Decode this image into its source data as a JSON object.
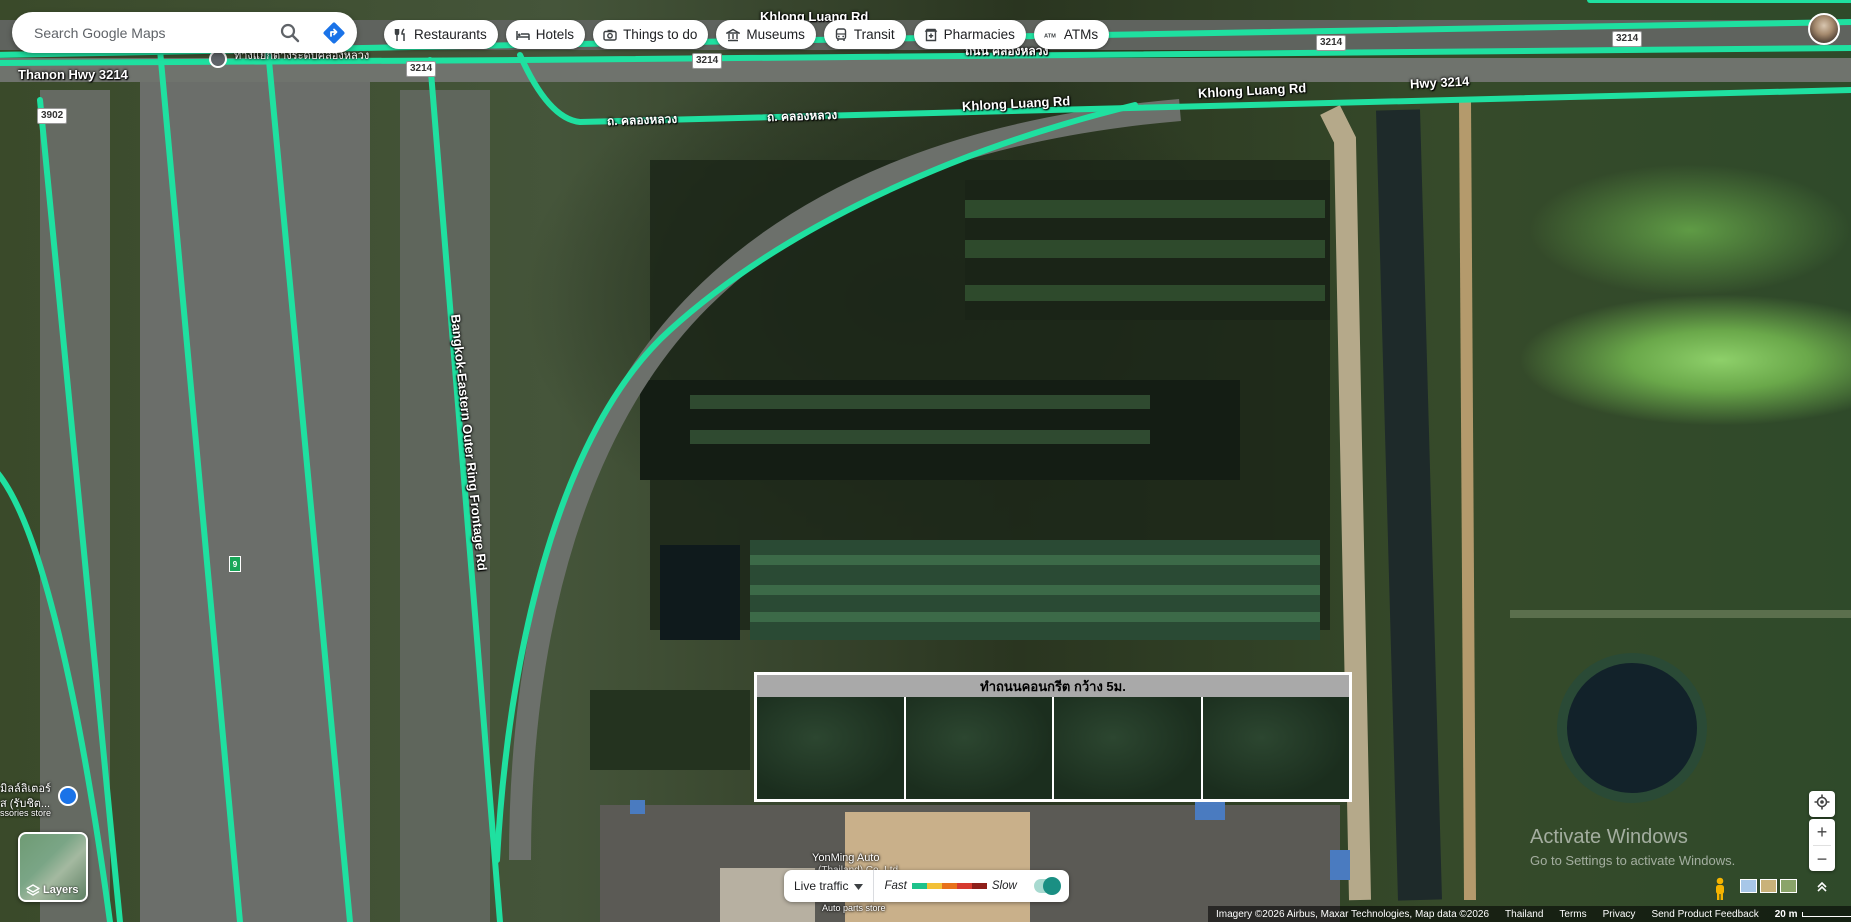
{
  "search": {
    "placeholder": "Search Google Maps"
  },
  "chips": [
    {
      "label": "Restaurants",
      "icon": "fork-knife-icon"
    },
    {
      "label": "Hotels",
      "icon": "bed-icon"
    },
    {
      "label": "Things to do",
      "icon": "camera-icon"
    },
    {
      "label": "Museums",
      "icon": "museum-icon"
    },
    {
      "label": "Transit",
      "icon": "bus-icon"
    },
    {
      "label": "Pharmacies",
      "icon": "pharmacy-icon"
    },
    {
      "label": "ATMs",
      "icon": "atm-icon"
    }
  ],
  "map_labels": {
    "road_top_thai_1": "Khlong Luang Rd",
    "road_top_thai_2": "ถนน คลองหลวง",
    "thanon_hwy": "Thanon Hwy 3214",
    "thai_road_1": "ถ. คลองหลวง",
    "thai_road_2": "ถ. คลองหลวง",
    "khlong_luang_rd": "Khlong Luang Rd",
    "khlong_luang_rd_2": "Khlong Luang Rd",
    "hwy_3214": "Hwy 3214",
    "frontage_rd": "Bangkok-Eastern Outer Ring Frontage Rd",
    "poi_top_left": "ทางแยกต่างระดับคลองหลวง",
    "poi_bottom_left_1": "มิลล์ลิเตอร์",
    "poi_bottom_left_2": "ส (รับชิต...",
    "poi_bottom_left_3": "ssories store",
    "yonming": "YonMing Auto",
    "yonming_sub": "(Thailand) Co.,Ltd.",
    "auto_parts": "Auto parts store"
  },
  "shields": {
    "s1": "3214",
    "s2": "3214",
    "s3": "3214",
    "s4": "3214",
    "s5": "3902"
  },
  "hwy_marker": "9",
  "site_sign": {
    "title": "ทำถนนคอนกรีต กว้าง 5ม."
  },
  "layers": {
    "label": "Layers"
  },
  "traffic": {
    "dropdown_label": "Live traffic",
    "fast_label": "Fast",
    "slow_label": "Slow",
    "colors": [
      "#1ec28b",
      "#f2c037",
      "#e8711a",
      "#d63a2f",
      "#8e1f1a"
    ]
  },
  "footer": {
    "imagery": "Imagery ©2026 Airbus, Maxar Technologies, Map data ©2026",
    "country": "Thailand",
    "terms": "Terms",
    "privacy": "Privacy",
    "feedback": "Send Product Feedback",
    "scale": "20 m"
  },
  "activate": {
    "line1": "Activate Windows",
    "line2": "Go to Settings to activate Windows."
  },
  "colors": {
    "road_highlight": "#1fe0a0",
    "road_gray": "#7c7c7c"
  }
}
